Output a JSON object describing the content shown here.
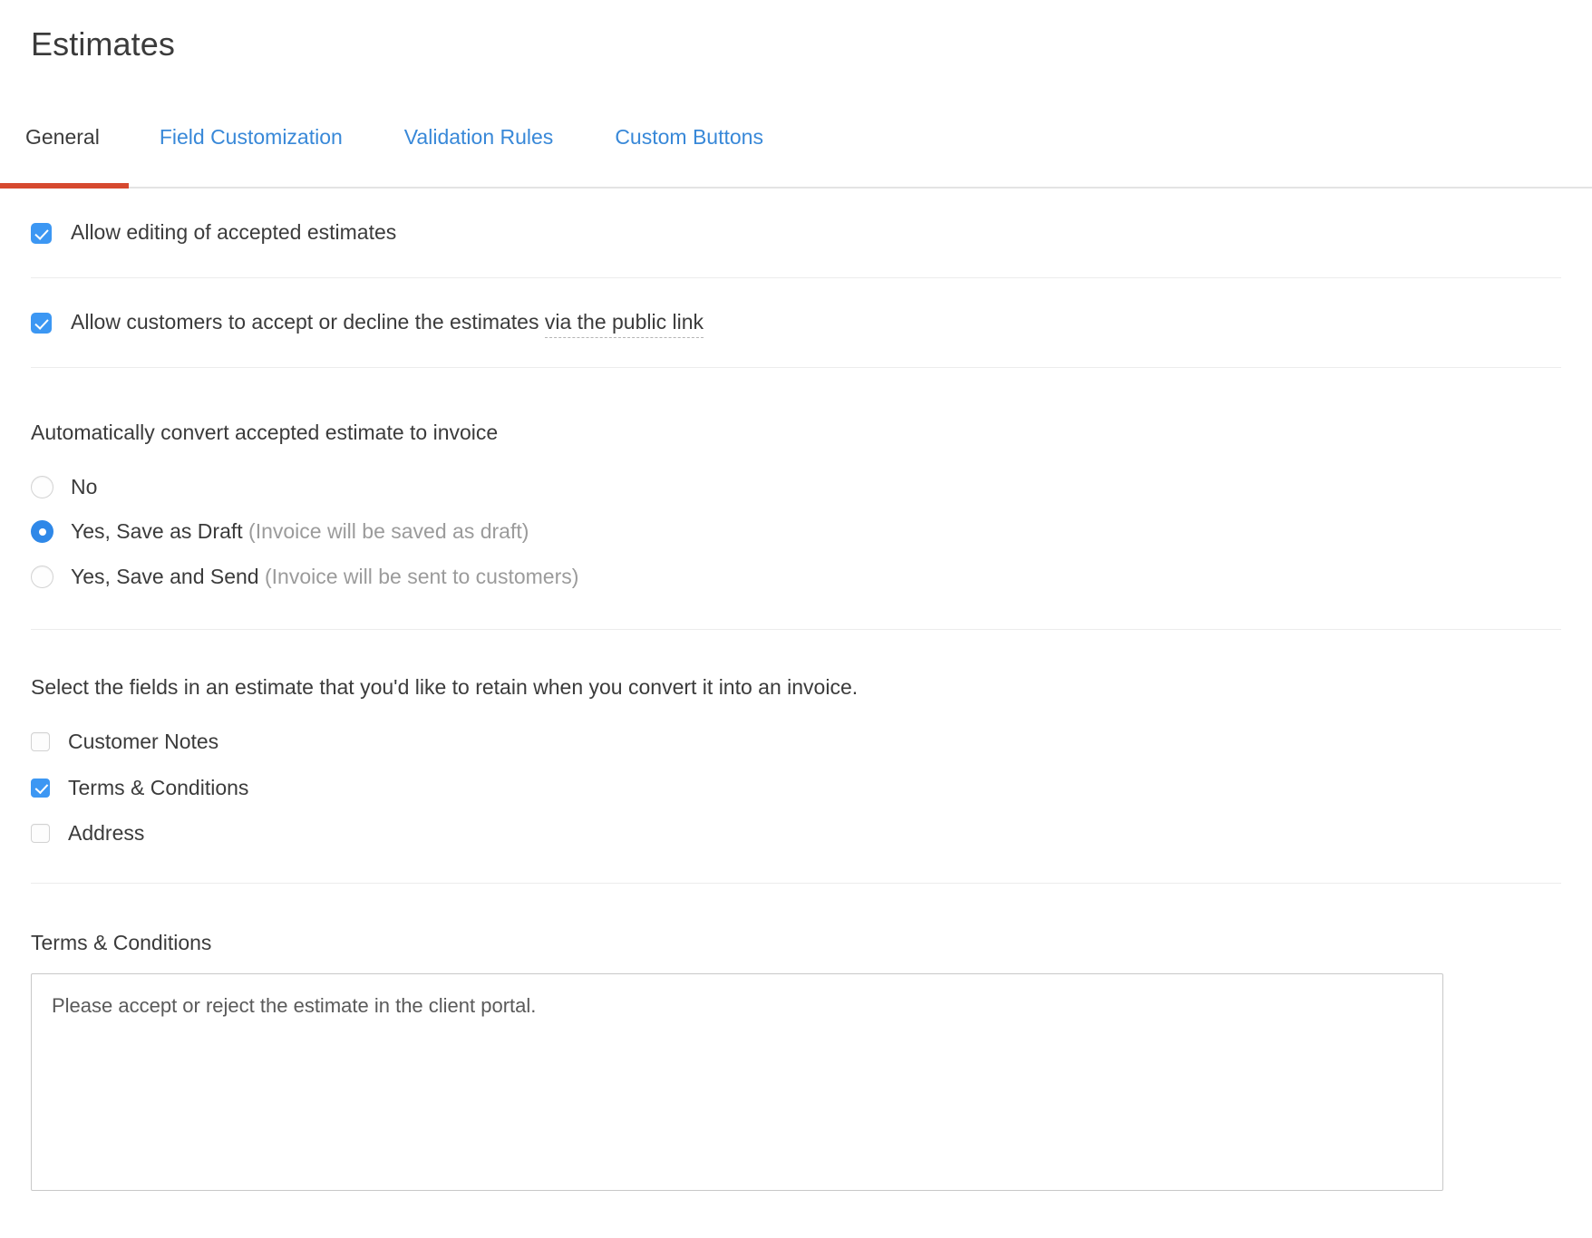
{
  "page": {
    "title": "Estimates"
  },
  "tabs": [
    {
      "label": "General",
      "active": true
    },
    {
      "label": "Field Customization",
      "active": false
    },
    {
      "label": "Validation Rules",
      "active": false
    },
    {
      "label": "Custom Buttons",
      "active": false
    }
  ],
  "settings": {
    "allow_editing": {
      "label": "Allow editing of accepted estimates",
      "checked": true
    },
    "allow_public_accept": {
      "label_prefix": "Allow customers to accept or decline the estimates",
      "link_text": "via the public link",
      "checked": true
    },
    "auto_convert": {
      "heading": "Automatically convert accepted estimate to invoice",
      "options": [
        {
          "label": "No",
          "hint": "",
          "selected": false
        },
        {
          "label": "Yes, Save as Draft",
          "hint": "(Invoice will be saved as draft)",
          "selected": true
        },
        {
          "label": "Yes, Save and Send",
          "hint": "(Invoice will be sent to customers)",
          "selected": false
        }
      ]
    },
    "retain_fields": {
      "heading": "Select the fields in an estimate that you'd like to retain when you convert it into an invoice.",
      "items": [
        {
          "label": "Customer Notes",
          "checked": false
        },
        {
          "label": "Terms & Conditions",
          "checked": true
        },
        {
          "label": "Address",
          "checked": false
        }
      ]
    },
    "terms": {
      "label": "Terms & Conditions",
      "value": "Please accept or reject the estimate in the client portal.",
      "placeholder": "Please accept or reject the estimate in the client portal."
    }
  },
  "colors": {
    "accent_red": "#d6492f",
    "link_blue": "#3888d8",
    "control_blue": "#3c97f3",
    "text": "#3b3b3b",
    "muted": "#9b9b9b"
  }
}
